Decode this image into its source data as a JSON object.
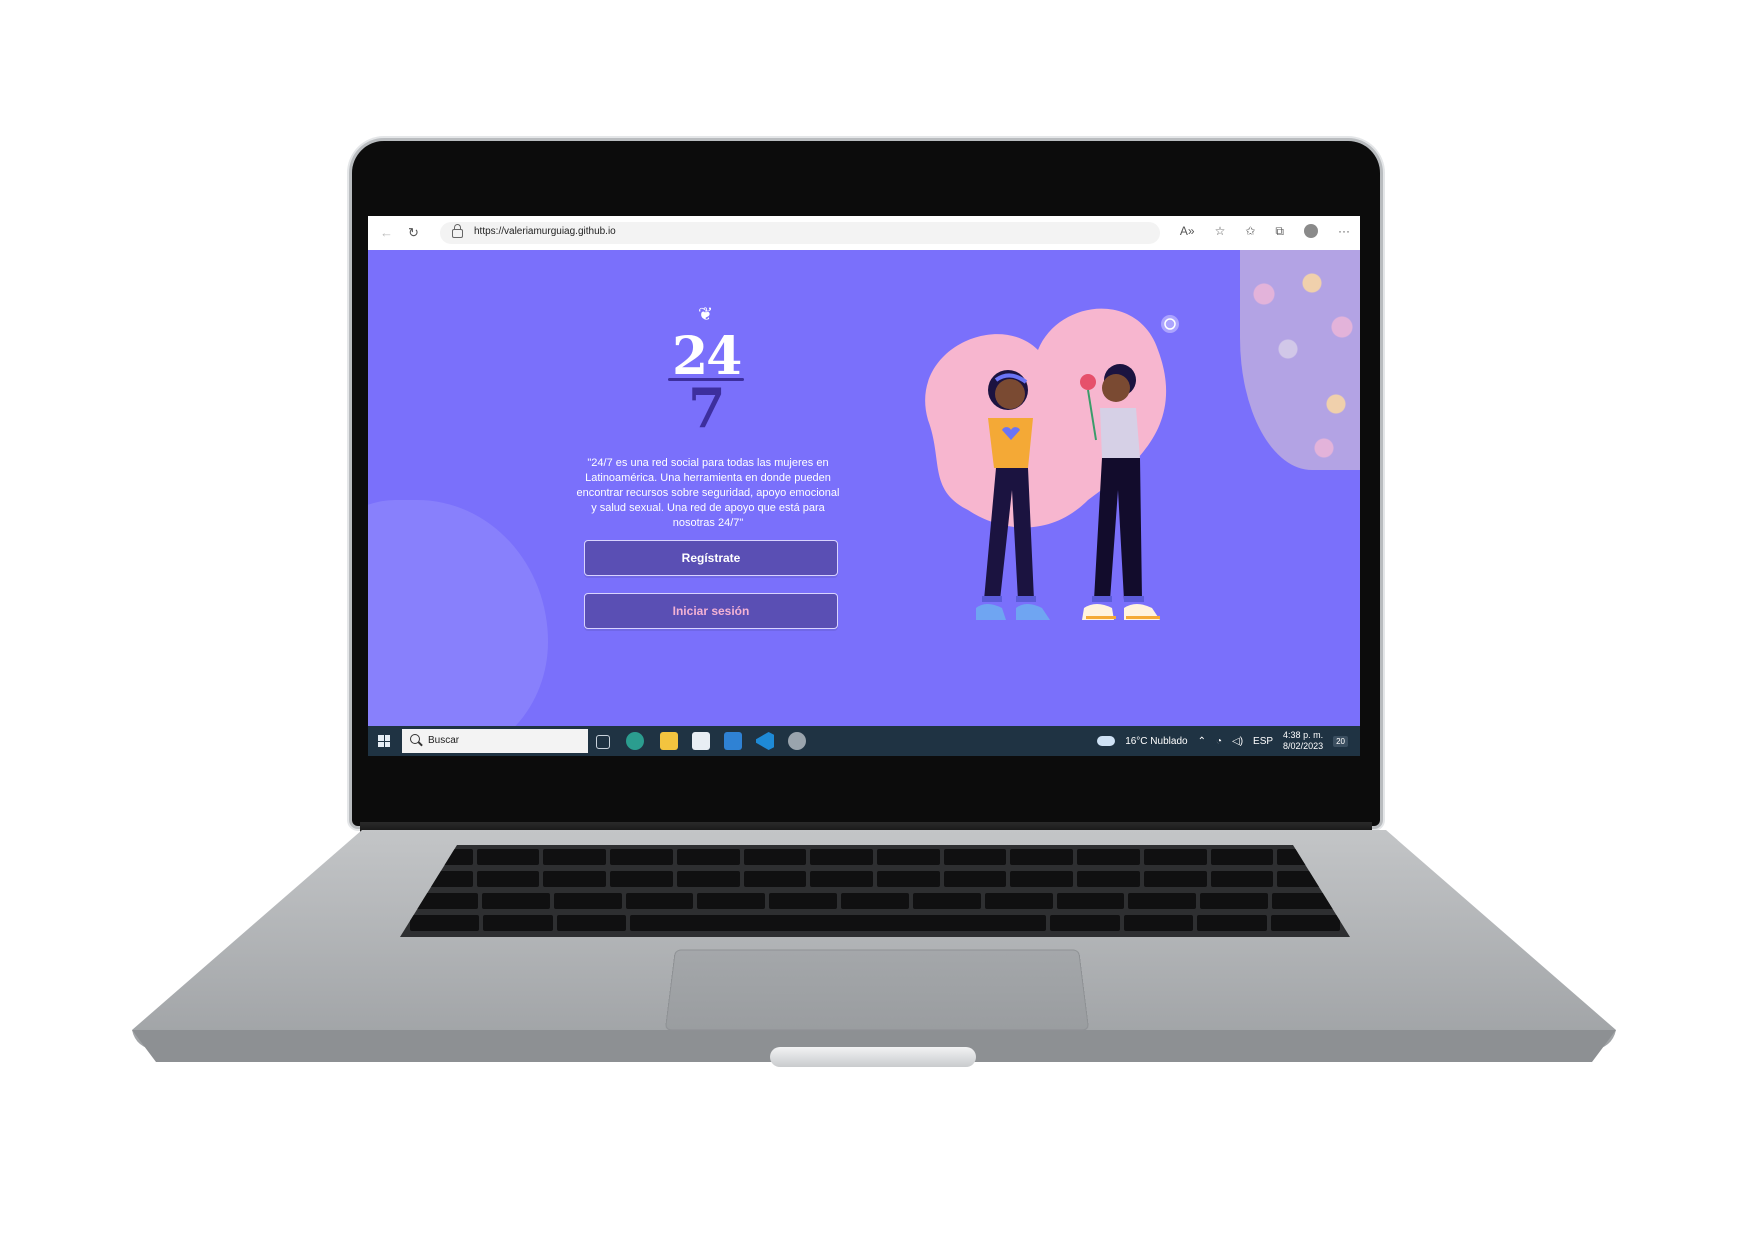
{
  "browser": {
    "url": "https://valeriamurguiag.github.io"
  },
  "page": {
    "logo_top": "24",
    "logo_bottom": "7",
    "tagline": "\"24/7 es una red social para todas las mujeres en Latinoamérica. Una herramienta en donde pueden encontrar recursos sobre seguridad, apoyo emocional y salud sexual. Una red de apoyo que está para nosotras 24/7\"",
    "register_label": "Regístrate",
    "login_label": "Iniciar sesión"
  },
  "taskbar": {
    "search_placeholder": "Buscar",
    "weather": "16°C  Nublado",
    "language": "ESP",
    "time": "4:38 p. m.",
    "date": "8/02/2023",
    "notifications": "20"
  },
  "colors": {
    "page_bg": "#7a70fb",
    "button_bg": "#5a4fb4",
    "login_text": "#f3b2d4",
    "taskbar_bg": "#1f3343"
  },
  "icons": [
    "back-arrow-icon",
    "refresh-icon",
    "lock-icon",
    "read-aloud-icon",
    "favorite-icon",
    "favorites-icon",
    "collections-icon",
    "profile-icon",
    "more-icon",
    "windows-icon",
    "search-icon",
    "task-view-icon",
    "edge-icon",
    "file-explorer-icon",
    "store-icon",
    "mail-icon",
    "vscode-icon",
    "chrome-icon",
    "cloud-icon"
  ]
}
